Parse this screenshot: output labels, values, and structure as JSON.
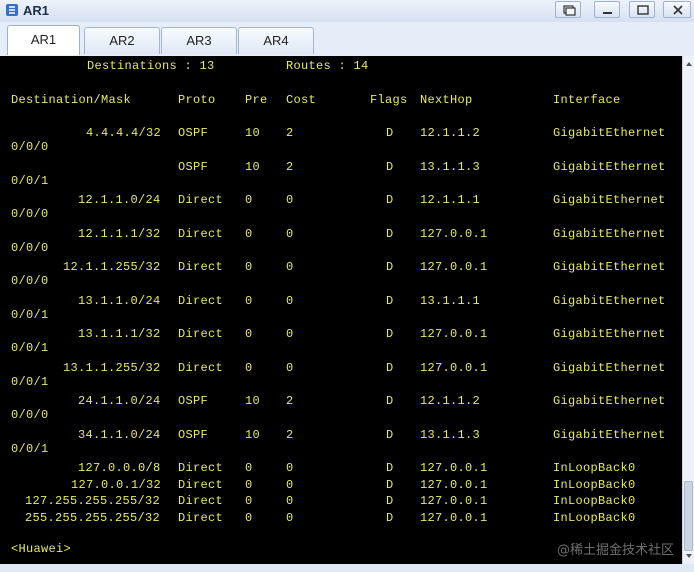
{
  "window": {
    "title": "AR1"
  },
  "tabs": [
    {
      "label": "AR1",
      "active": true
    },
    {
      "label": "AR2",
      "active": false
    },
    {
      "label": "AR3",
      "active": false
    },
    {
      "label": "AR4",
      "active": false
    }
  ],
  "terminal": {
    "summary": {
      "destinations": "Destinations : 13",
      "routes": "Routes : 14"
    },
    "headers": {
      "destination": "Destination/Mask",
      "proto": "Proto",
      "pre": "Pre",
      "cost": "Cost",
      "flags": "Flags",
      "nexthop": "NextHop",
      "interface": "Interface"
    },
    "rows": [
      {
        "dest": "4.4.4.4/32",
        "proto": "OSPF",
        "pre": "10",
        "cost": "2",
        "flag": "D",
        "nexthop": "12.1.1.2",
        "iface": "GigabitEthernet",
        "cont": "0/0/0"
      },
      {
        "dest": "",
        "proto": "OSPF",
        "pre": "10",
        "cost": "2",
        "flag": "D",
        "nexthop": "13.1.1.3",
        "iface": "GigabitEthernet",
        "cont": "0/0/1"
      },
      {
        "dest": "12.1.1.0/24",
        "proto": "Direct",
        "pre": "0",
        "cost": "0",
        "flag": "D",
        "nexthop": "12.1.1.1",
        "iface": "GigabitEthernet",
        "cont": "0/0/0"
      },
      {
        "dest": "12.1.1.1/32",
        "proto": "Direct",
        "pre": "0",
        "cost": "0",
        "flag": "D",
        "nexthop": "127.0.0.1",
        "iface": "GigabitEthernet",
        "cont": "0/0/0"
      },
      {
        "dest": "12.1.1.255/32",
        "proto": "Direct",
        "pre": "0",
        "cost": "0",
        "flag": "D",
        "nexthop": "127.0.0.1",
        "iface": "GigabitEthernet",
        "cont": "0/0/0"
      },
      {
        "dest": "13.1.1.0/24",
        "proto": "Direct",
        "pre": "0",
        "cost": "0",
        "flag": "D",
        "nexthop": "13.1.1.1",
        "iface": "GigabitEthernet",
        "cont": "0/0/1"
      },
      {
        "dest": "13.1.1.1/32",
        "proto": "Direct",
        "pre": "0",
        "cost": "0",
        "flag": "D",
        "nexthop": "127.0.0.1",
        "iface": "GigabitEthernet",
        "cont": "0/0/1"
      },
      {
        "dest": "13.1.1.255/32",
        "proto": "Direct",
        "pre": "0",
        "cost": "0",
        "flag": "D",
        "nexthop": "127.0.0.1",
        "iface": "GigabitEthernet",
        "cont": "0/0/1"
      },
      {
        "dest": "24.1.1.0/24",
        "proto": "OSPF",
        "pre": "10",
        "cost": "2",
        "flag": "D",
        "nexthop": "12.1.1.2",
        "iface": "GigabitEthernet",
        "cont": "0/0/0"
      },
      {
        "dest": "34.1.1.0/24",
        "proto": "OSPF",
        "pre": "10",
        "cost": "2",
        "flag": "D",
        "nexthop": "13.1.1.3",
        "iface": "GigabitEthernet",
        "cont": "0/0/1"
      },
      {
        "dest": "127.0.0.0/8",
        "proto": "Direct",
        "pre": "0",
        "cost": "0",
        "flag": "D",
        "nexthop": "127.0.0.1",
        "iface": "InLoopBack0",
        "cont": ""
      },
      {
        "dest": "127.0.0.1/32",
        "proto": "Direct",
        "pre": "0",
        "cost": "0",
        "flag": "D",
        "nexthop": "127.0.0.1",
        "iface": "InLoopBack0",
        "cont": ""
      },
      {
        "dest": "127.255.255.255/32",
        "proto": "Direct",
        "pre": "0",
        "cost": "0",
        "flag": "D",
        "nexthop": "127.0.0.1",
        "iface": "InLoopBack0",
        "cont": ""
      },
      {
        "dest": "255.255.255.255/32",
        "proto": "Direct",
        "pre": "0",
        "cost": "0",
        "flag": "D",
        "nexthop": "127.0.0.1",
        "iface": "InLoopBack0",
        "cont": ""
      }
    ],
    "prompt": "<Huawei>"
  },
  "watermark": "@稀土掘金技术社区",
  "colors": {
    "terminal_bg": "#000000",
    "terminal_text": "#e8e86a"
  },
  "icons": [
    "app-icon",
    "restore-icon",
    "minimize-icon",
    "maximize-icon",
    "close-icon",
    "scroll-up-icon",
    "scroll-down-icon"
  ]
}
